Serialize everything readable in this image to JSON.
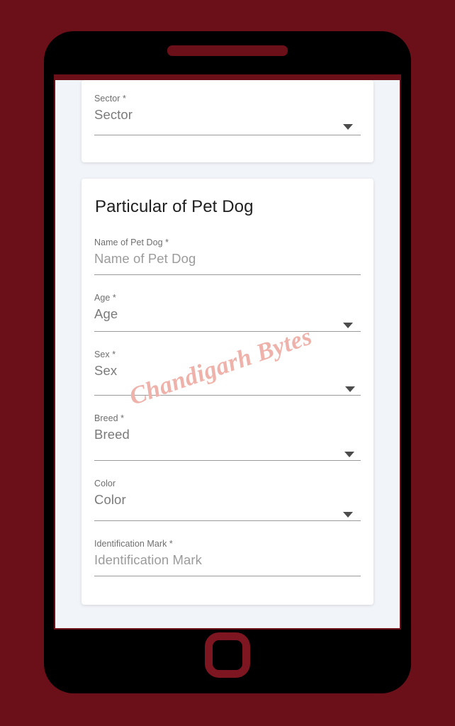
{
  "device": {
    "speaker_label": "speaker-slot",
    "home_button_label": "home-button",
    "frame_color": "#000000",
    "accent_color": "#6b1019",
    "background_color": "#6b1019"
  },
  "screen": {
    "background_color": "#f1f4f9",
    "topbar_color": "#6b1019"
  },
  "watermark": {
    "text": "Chandigarh Bytes",
    "color": "#eeb2aa"
  },
  "cards": [
    {
      "id": "sector",
      "title": "",
      "fields": [
        {
          "id": "sector",
          "label": "Sector *",
          "value": "Sector",
          "type": "select",
          "required": true
        }
      ]
    },
    {
      "id": "petdog",
      "title": "Particular of Pet Dog",
      "fields": [
        {
          "id": "name",
          "label": "Name of Pet Dog *",
          "value": "Name of Pet Dog",
          "type": "text",
          "required": true
        },
        {
          "id": "age",
          "label": "Age *",
          "value": "Age",
          "type": "select",
          "required": true
        },
        {
          "id": "sex",
          "label": "Sex *",
          "value": "Sex",
          "type": "select",
          "required": true
        },
        {
          "id": "breed",
          "label": "Breed *",
          "value": "Breed",
          "type": "select",
          "required": true
        },
        {
          "id": "color",
          "label": "Color",
          "value": "Color",
          "type": "select",
          "required": false
        },
        {
          "id": "idmark",
          "label": "Identification Mark *",
          "value": "Identification Mark",
          "type": "text",
          "required": true
        }
      ]
    }
  ]
}
